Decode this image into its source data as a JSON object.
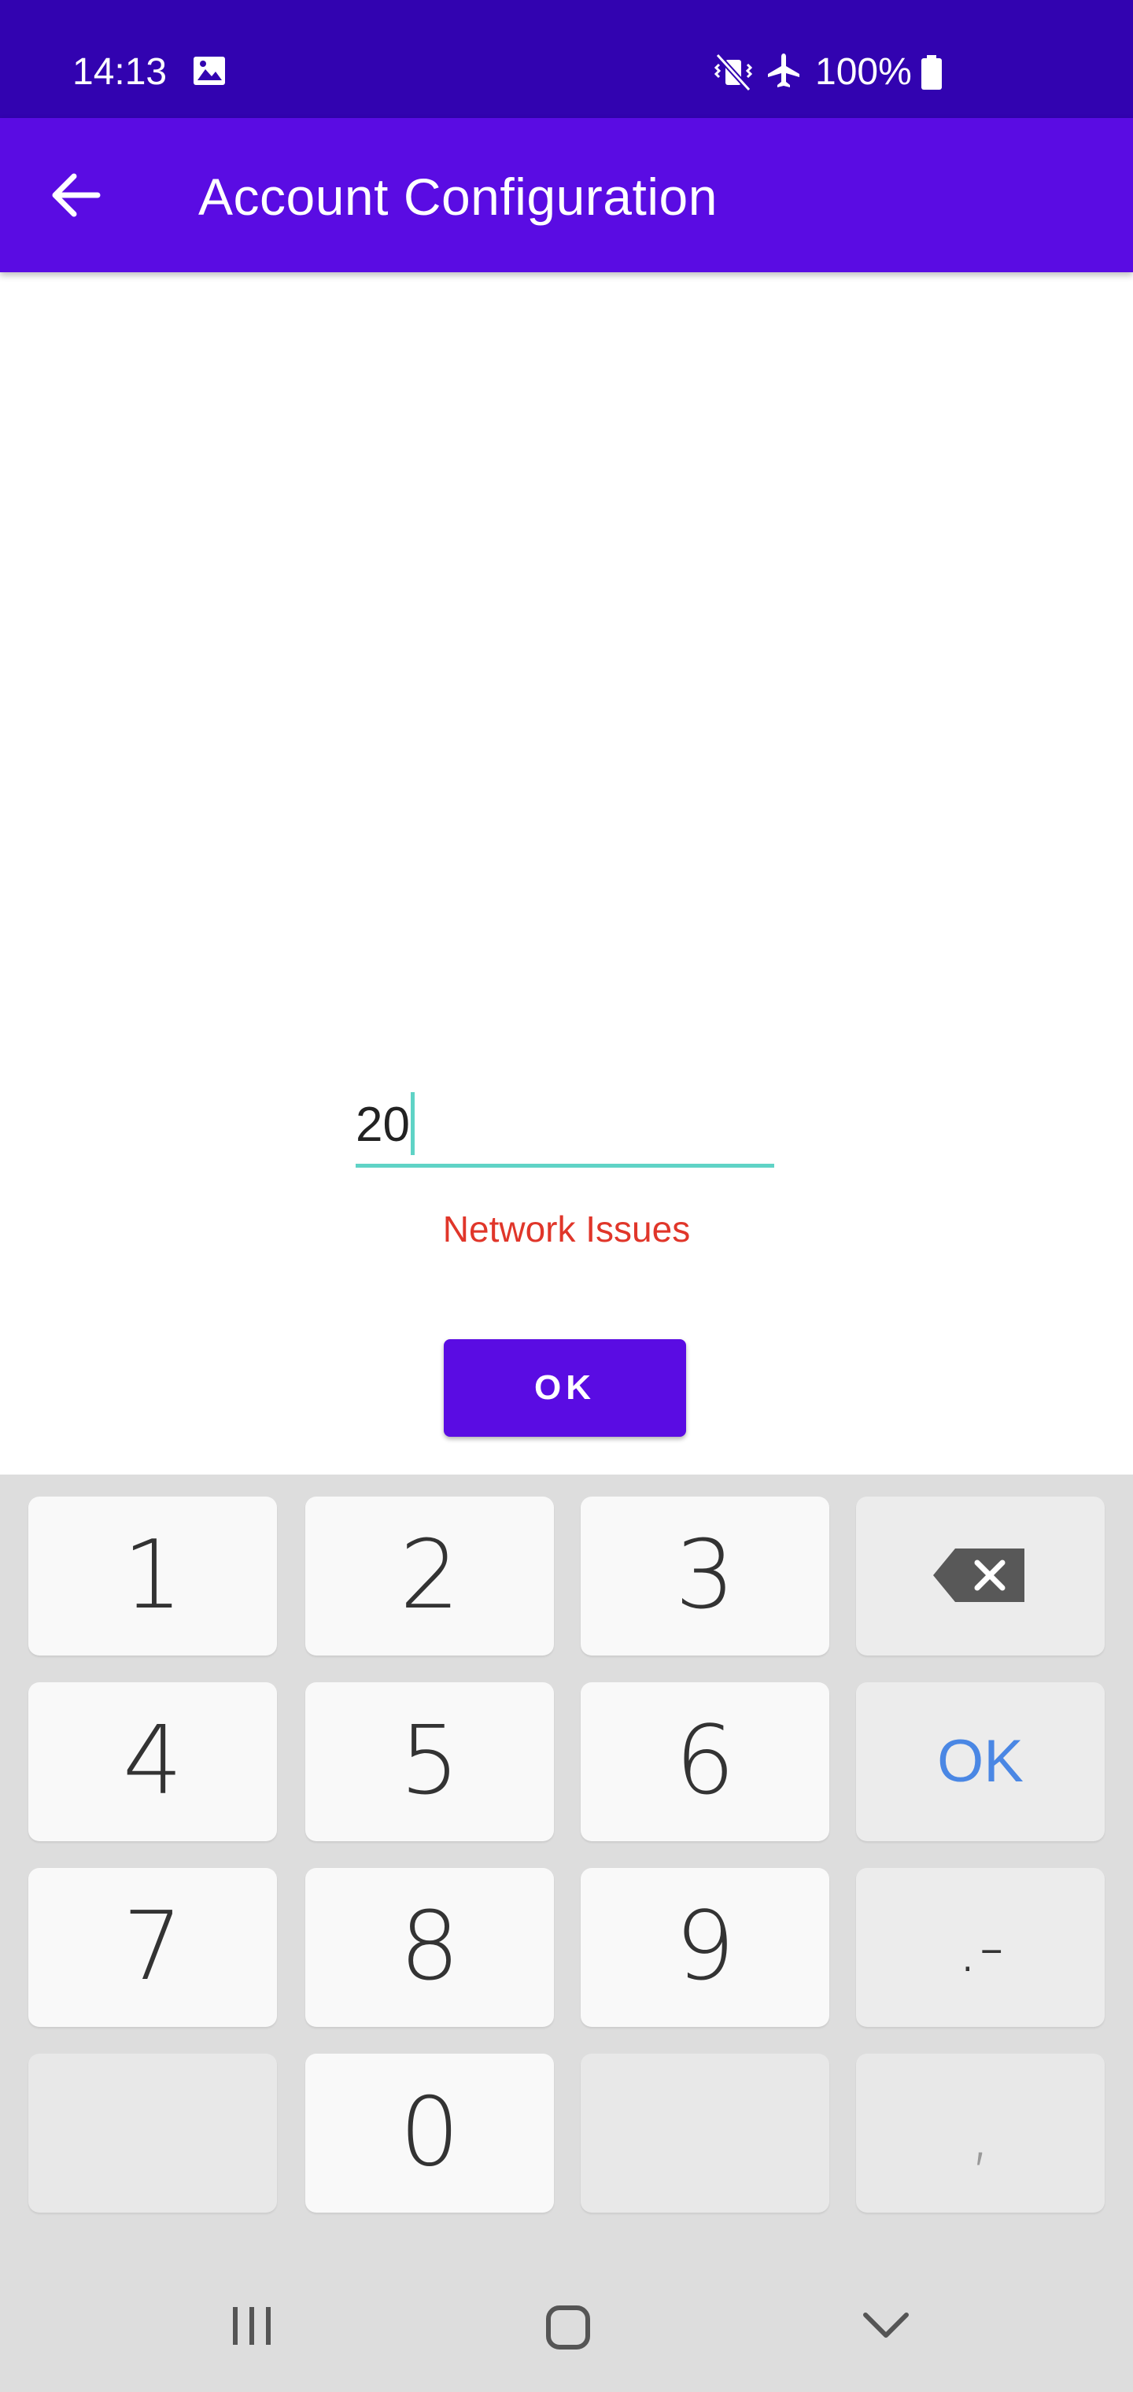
{
  "status_bar": {
    "time": "14:13",
    "battery_percent": "100%",
    "icons": [
      "gallery-icon",
      "mute-vibrate-icon",
      "airplane-mode-icon",
      "battery-icon"
    ]
  },
  "app_bar": {
    "title": "Account Configuration",
    "back_icon": "arrow-back-icon"
  },
  "form": {
    "input_value": "20",
    "error_message": "Network Issues",
    "ok_label": "OK"
  },
  "keyboard": {
    "rows": [
      [
        "1",
        "2",
        "3",
        "backspace"
      ],
      [
        "4",
        "5",
        "6",
        "OK"
      ],
      [
        "7",
        "8",
        "9",
        ".-"
      ],
      [
        "",
        "0",
        "",
        ","
      ]
    ],
    "k1": "1",
    "k2": "2",
    "k3": "3",
    "k4": "4",
    "k5": "5",
    "k6": "6",
    "k7": "7",
    "k8": "8",
    "k9": "9",
    "k0": "0",
    "ok": "OK",
    "dot_minus": ".-",
    "comma": ","
  },
  "nav_bar": {
    "icons": [
      "recent-apps-icon",
      "home-icon",
      "back-chevron-icon"
    ]
  },
  "colors": {
    "status_bar": "#3203b0",
    "app_bar": "#5a0ce3",
    "accent_underline": "#5fd3c6",
    "error": "#e0362a",
    "keyboard_ok": "#4a87e4"
  }
}
